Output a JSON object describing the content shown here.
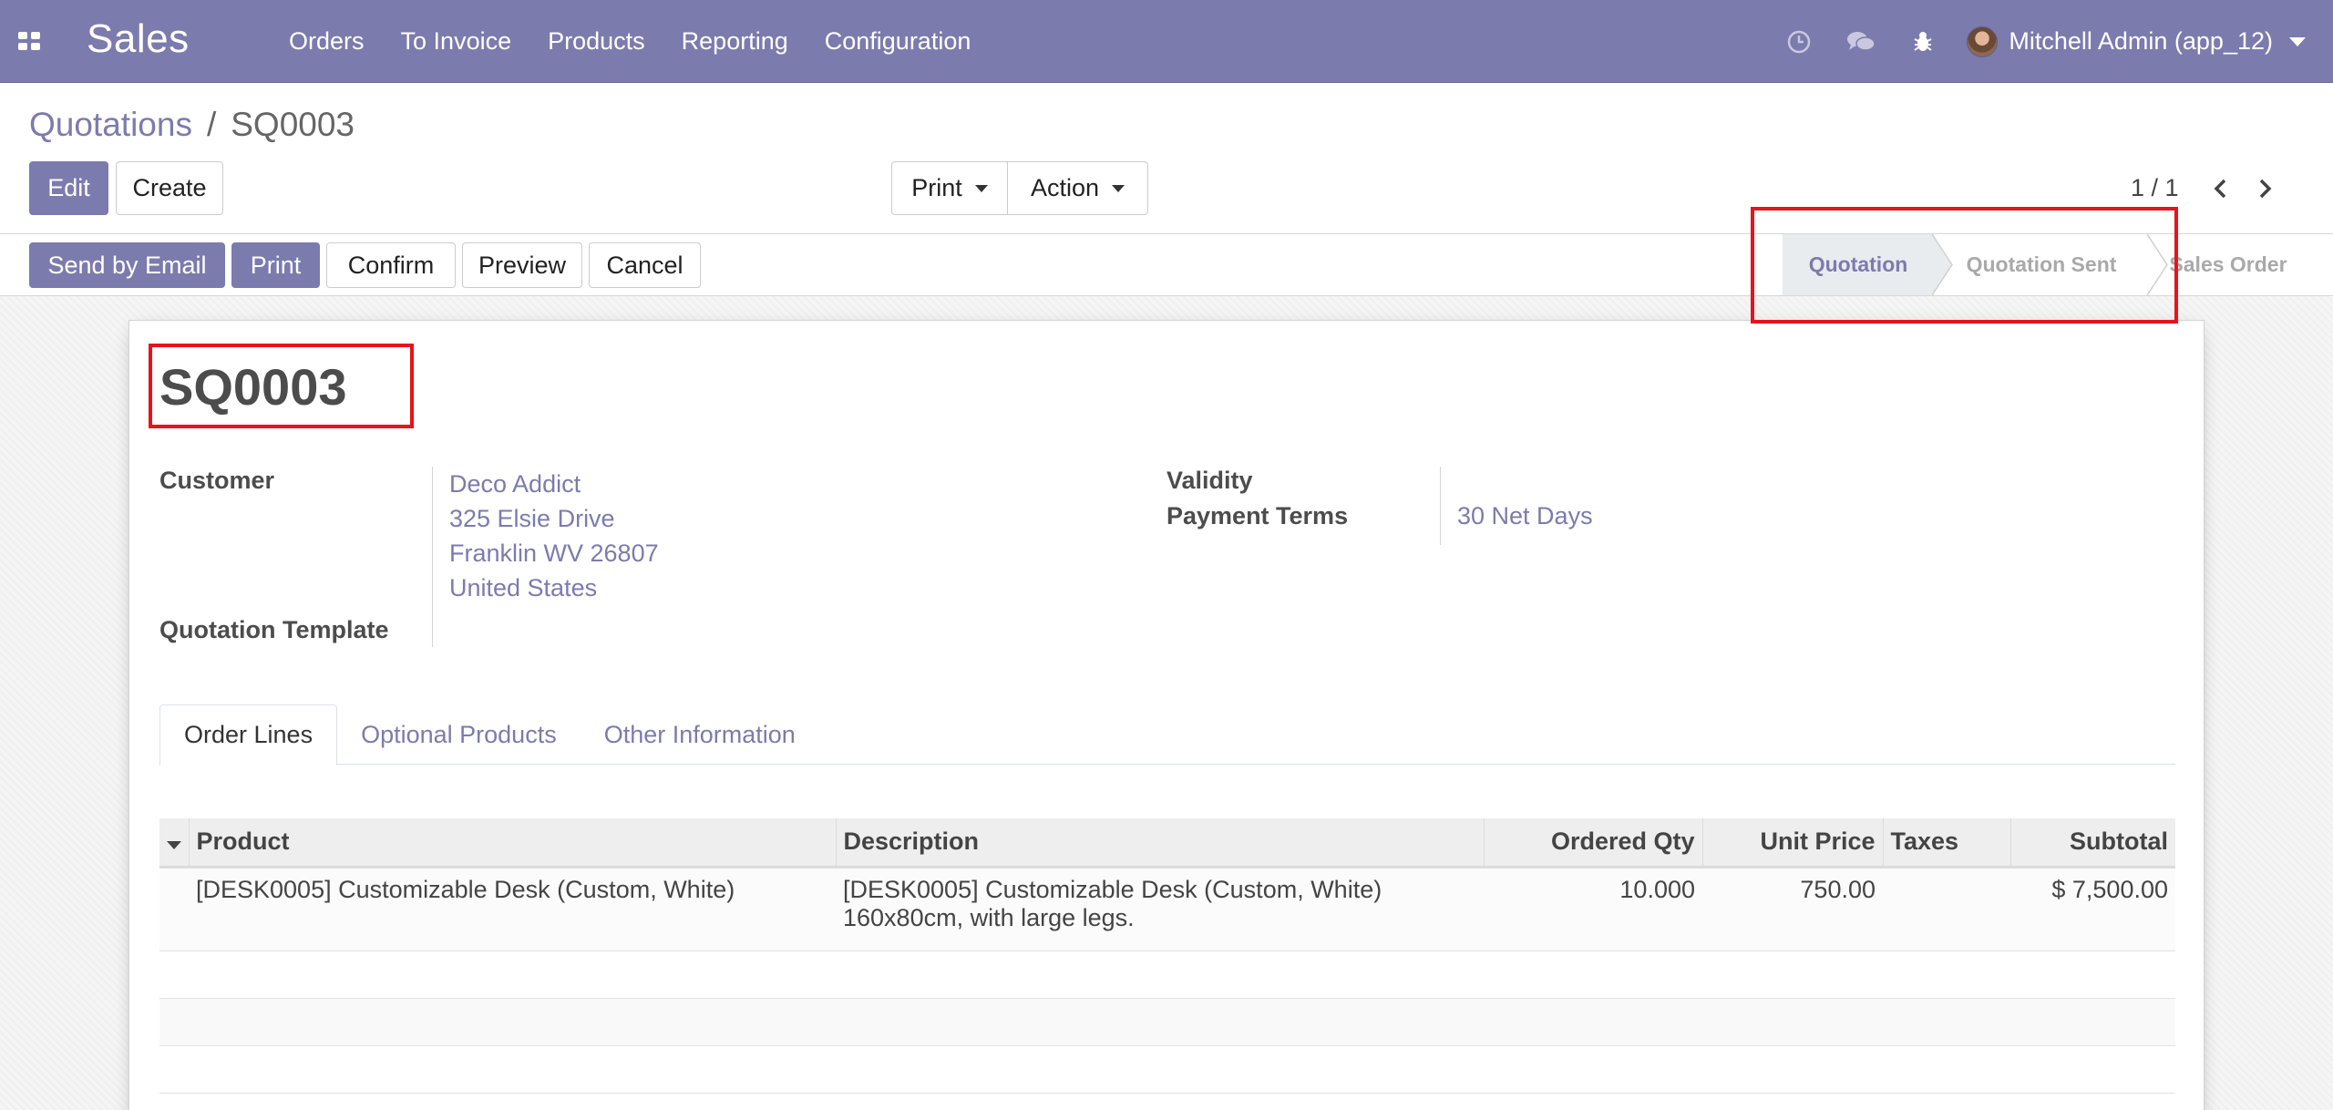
{
  "navbar": {
    "app_name": "Sales",
    "menu": [
      "Orders",
      "To Invoice",
      "Products",
      "Reporting",
      "Configuration"
    ],
    "user": "Mitchell Admin (app_12)",
    "icons": [
      "apps-icon",
      "clock-icon",
      "chat-icon",
      "bug-icon",
      "caret-down-icon"
    ]
  },
  "breadcrumb": {
    "parent": "Quotations",
    "separator": "/",
    "current": "SQ0003"
  },
  "control_panel": {
    "edit": "Edit",
    "create": "Create",
    "print": "Print",
    "action": "Action",
    "pager": "1 / 1"
  },
  "status_bar": {
    "buttons": [
      "Send by Email",
      "Print",
      "Confirm",
      "Preview",
      "Cancel"
    ],
    "stages": [
      "Quotation",
      "Quotation Sent",
      "Sales Order"
    ],
    "active_stage": "Quotation"
  },
  "form": {
    "name": "SQ0003",
    "customer_label": "Customer",
    "customer_lines": [
      "Deco Addict",
      "325 Elsie Drive",
      "Franklin WV 26807",
      "United States"
    ],
    "template_label": "Quotation Template",
    "validity_label": "Validity",
    "payment_terms_label": "Payment Terms",
    "payment_terms_value": "30 Net Days"
  },
  "tabs": [
    "Order Lines",
    "Optional Products",
    "Other Information"
  ],
  "order_lines": {
    "columns": [
      "Product",
      "Description",
      "Ordered Qty",
      "Unit Price",
      "Taxes",
      "Subtotal"
    ],
    "rows": [
      {
        "product": "[DESK0005] Customizable Desk (Custom, White)",
        "description_lines": [
          "[DESK0005] Customizable Desk (Custom, White)",
          "160x80cm, with large legs."
        ],
        "qty": "10.000",
        "unit_price": "750.00",
        "taxes": "",
        "subtotal": "$ 7,500.00"
      }
    ]
  },
  "colors": {
    "brand": "#7c7bad",
    "highlight": "#e8131b"
  }
}
